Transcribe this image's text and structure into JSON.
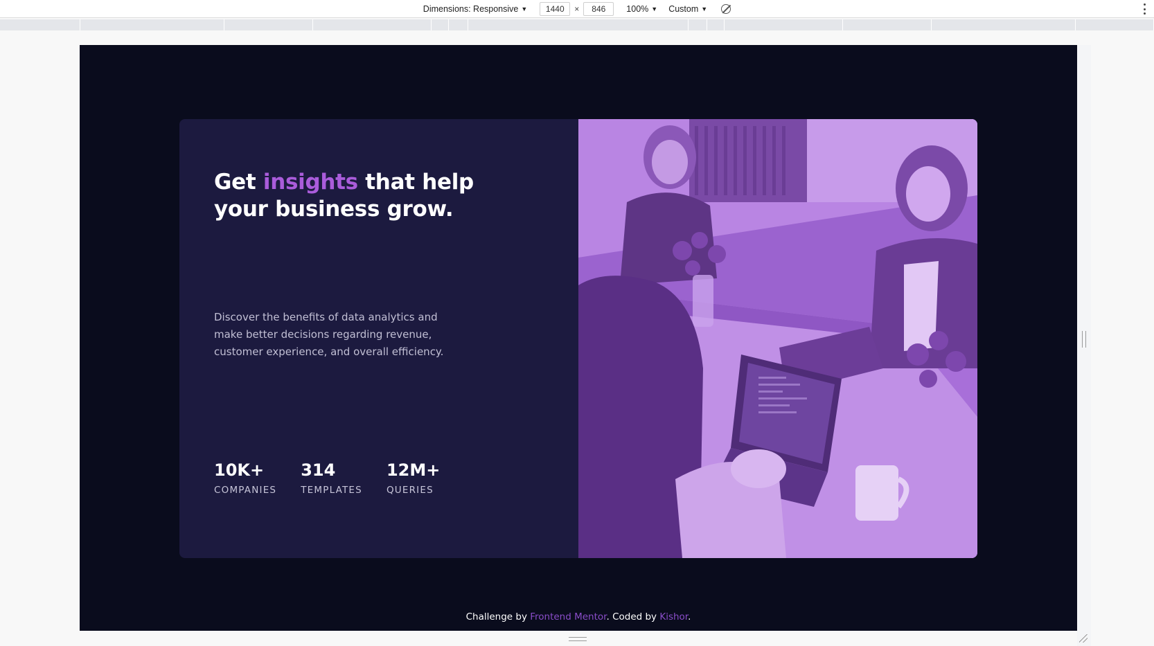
{
  "devtools": {
    "dimensions_label": "Dimensions: Responsive",
    "width_value": "1440",
    "height_value": "846",
    "times": "×",
    "zoom": "100%",
    "throttle": "Custom",
    "icons": {
      "rotate": "rotate-icon",
      "more": "more-vertical-icon"
    }
  },
  "hero": {
    "headline_prefix": "Get ",
    "headline_accent": "insights",
    "headline_suffix": " that help your business grow.",
    "description": "Discover the benefits of data analytics and make better decisions regarding revenue, customer experience, and overall efficiency."
  },
  "stats": [
    {
      "value": "10K+",
      "label": "COMPANIES"
    },
    {
      "value": "314",
      "label": "TEMPLATES"
    },
    {
      "value": "12M+",
      "label": "QUERIES"
    }
  ],
  "attribution": {
    "prefix": "Challenge by ",
    "link1": "Frontend Mentor",
    "middle": ". Coded by ",
    "link2": "Kishor",
    "suffix": "."
  },
  "colors": {
    "page_bg": "#0a0c1d",
    "card_bg": "#1c1a3f",
    "accent": "#aa5cdb",
    "image_overlay": "#a66ad8",
    "link": "#8a4dc9"
  }
}
